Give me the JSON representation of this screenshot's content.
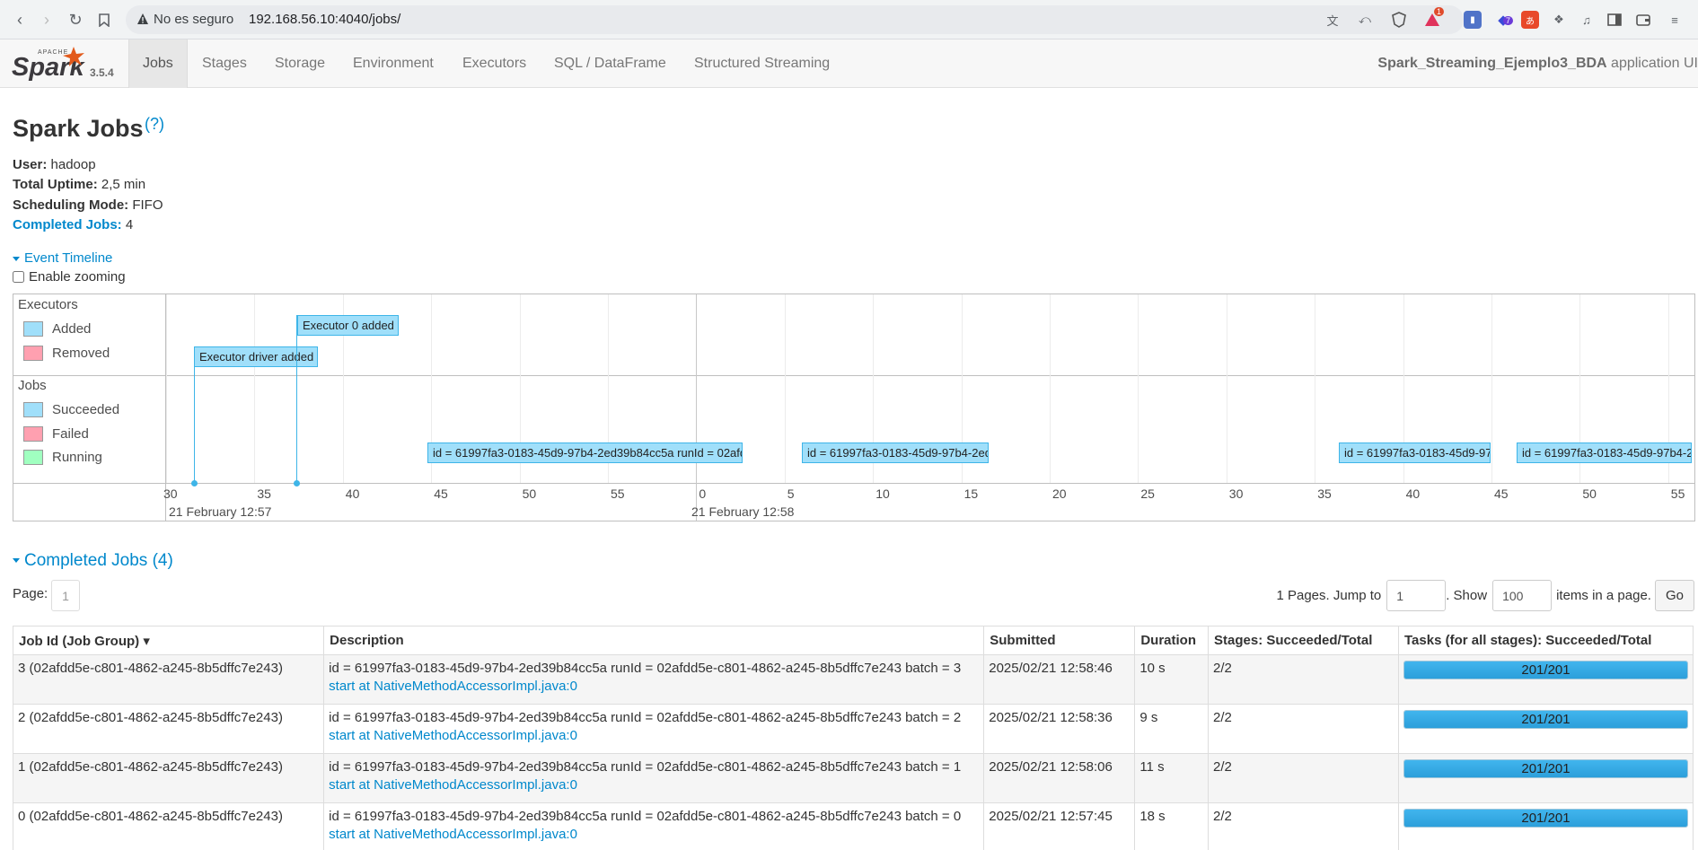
{
  "browser": {
    "security_label": "No es seguro",
    "url": "192.168.56.10:4040/jobs/",
    "notification_count": "1",
    "ext_badge_count": "7"
  },
  "navbar": {
    "version": "3.5.4",
    "tabs": [
      "Jobs",
      "Stages",
      "Storage",
      "Environment",
      "Executors",
      "SQL / DataFrame",
      "Structured Streaming"
    ],
    "app_name": "Spark_Streaming_Ejemplo3_BDA",
    "app_suffix": " application UI"
  },
  "page": {
    "title": "Spark Jobs",
    "help": "(?)",
    "user_label": "User:",
    "user": "hadoop",
    "uptime_label": "Total Uptime:",
    "uptime": "2,5 min",
    "mode_label": "Scheduling Mode:",
    "mode": "FIFO",
    "completed_label": "Completed Jobs:",
    "completed_count": "4"
  },
  "timeline": {
    "toggle_label": "Event Timeline",
    "zoom_label": "Enable zooming",
    "executors_group": "Executors",
    "executor_legend": [
      "Added",
      "Removed"
    ],
    "jobs_group": "Jobs",
    "job_legend": [
      "Succeeded",
      "Failed",
      "Running"
    ],
    "colors": {
      "added": "#a0dffa",
      "removed": "#ffa0b0",
      "succeeded": "#a0dffa",
      "failed": "#ffa0b0",
      "running": "#a0ffc0"
    },
    "ticks": [
      "30",
      "35",
      "40",
      "45",
      "50",
      "55",
      "0",
      "5",
      "10",
      "15",
      "20",
      "25",
      "30",
      "35",
      "40",
      "45",
      "50",
      "55"
    ],
    "major_labels": [
      "21 February 12:57",
      "21 February 12:58"
    ],
    "executor_events": [
      "Executor driver added",
      "Executor 0 added"
    ],
    "job_events": [
      "id = 61997fa3-0183-45d9-97b4-2ed39b84cc5a runId = 02afd",
      "id = 61997fa3-0183-45d9-97b4-2ed",
      "id = 61997fa3-0183-45d9-97",
      "id = 61997fa3-0183-45d9-97b4-2"
    ]
  },
  "completed_jobs": {
    "toggle_label": "Completed Jobs (4)",
    "page_label": "Page:",
    "page_value": "1",
    "pages_text": "1 Pages. Jump to",
    "jump_value": "1",
    "show_text": ". Show",
    "show_value": "100",
    "items_text": "items in a page.",
    "go_label": "Go",
    "columns": [
      "Job Id (Job Group) ▾",
      "Description",
      "Submitted",
      "Duration",
      "Stages: Succeeded/Total",
      "Tasks (for all stages): Succeeded/Total"
    ],
    "rows": [
      {
        "id": "3 (02afdd5e-c801-4862-a245-8b5dffc7e243)",
        "desc": "id = 61997fa3-0183-45d9-97b4-2ed39b84cc5a runId = 02afdd5e-c801-4862-a245-8b5dffc7e243 batch = 3",
        "link": "start at NativeMethodAccessorImpl.java:0",
        "submitted": "2025/02/21 12:58:46",
        "duration": "10 s",
        "stages": "2/2",
        "tasks": "201/201",
        "progress": 1.0
      },
      {
        "id": "2 (02afdd5e-c801-4862-a245-8b5dffc7e243)",
        "desc": "id = 61997fa3-0183-45d9-97b4-2ed39b84cc5a runId = 02afdd5e-c801-4862-a245-8b5dffc7e243 batch = 2",
        "link": "start at NativeMethodAccessorImpl.java:0",
        "submitted": "2025/02/21 12:58:36",
        "duration": "9 s",
        "stages": "2/2",
        "tasks": "201/201",
        "progress": 1.0
      },
      {
        "id": "1 (02afdd5e-c801-4862-a245-8b5dffc7e243)",
        "desc": "id = 61997fa3-0183-45d9-97b4-2ed39b84cc5a runId = 02afdd5e-c801-4862-a245-8b5dffc7e243 batch = 1",
        "link": "start at NativeMethodAccessorImpl.java:0",
        "submitted": "2025/02/21 12:58:06",
        "duration": "11 s",
        "stages": "2/2",
        "tasks": "201/201",
        "progress": 1.0
      },
      {
        "id": "0 (02afdd5e-c801-4862-a245-8b5dffc7e243)",
        "desc": "id = 61997fa3-0183-45d9-97b4-2ed39b84cc5a runId = 02afdd5e-c801-4862-a245-8b5dffc7e243 batch = 0",
        "link": "start at NativeMethodAccessorImpl.java:0",
        "submitted": "2025/02/21 12:57:45",
        "duration": "18 s",
        "stages": "2/2",
        "tasks": "201/201",
        "progress": 1.0
      }
    ]
  }
}
